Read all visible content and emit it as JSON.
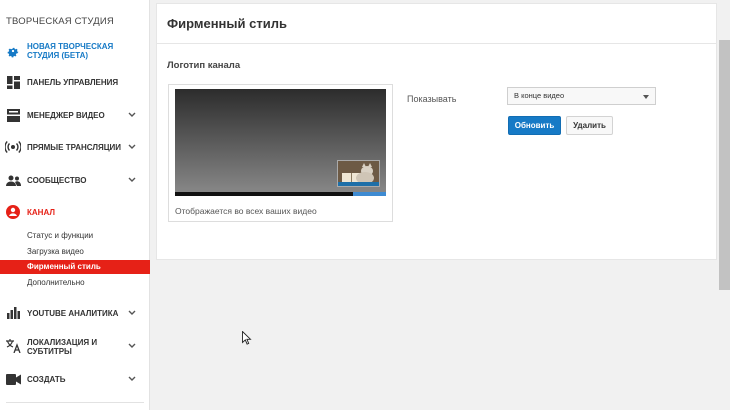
{
  "sidebar": {
    "studio_title": "ТВОРЧЕСКАЯ СТУДИЯ",
    "items": [
      {
        "label": "НОВАЯ ТВОРЧЕСКАЯ СТУДИЯ (БЕТА)",
        "icon": "gear-icon",
        "has_chevron": false
      },
      {
        "label": "ПАНЕЛЬ УПРАВЛЕНИЯ",
        "icon": "dashboard-icon",
        "has_chevron": false
      },
      {
        "label": "МЕНЕДЖЕР ВИДЕО",
        "icon": "video-manager-icon",
        "has_chevron": true
      },
      {
        "label": "ПРЯМЫЕ ТРАНСЛЯЦИИ",
        "icon": "live-broadcast-icon",
        "has_chevron": true
      },
      {
        "label": "СООБЩЕСТВО",
        "icon": "community-icon",
        "has_chevron": true
      },
      {
        "label": "КАНАЛ",
        "icon": "channel-icon",
        "has_chevron": false
      },
      {
        "label": "YOUTUBE АНАЛИТИКА",
        "icon": "analytics-icon",
        "has_chevron": true
      },
      {
        "label": "ЛОКАЛИЗАЦИЯ И СУБТИТРЫ",
        "icon": "translate-icon",
        "has_chevron": true
      },
      {
        "label": "СОЗДАТЬ",
        "icon": "create-video-icon",
        "has_chevron": true
      }
    ],
    "channel_subitems": [
      {
        "label": "Статус и функции",
        "active": false
      },
      {
        "label": "Загрузка видео",
        "active": false
      },
      {
        "label": "Фирменный стиль",
        "active": true
      },
      {
        "label": "Дополнительно",
        "active": false
      }
    ]
  },
  "main": {
    "title": "Фирменный стиль",
    "section_title": "Логотип канала",
    "preview_caption": "Отображается во всех ваших видео",
    "show_label": "Показывать",
    "show_select": {
      "selected": "В конце видео"
    },
    "update_button": "Обновить",
    "delete_button": "Удалить"
  },
  "colors": {
    "accent_blue": "#167ac6",
    "accent_red": "#e62117",
    "background": "#f1f1f1"
  }
}
